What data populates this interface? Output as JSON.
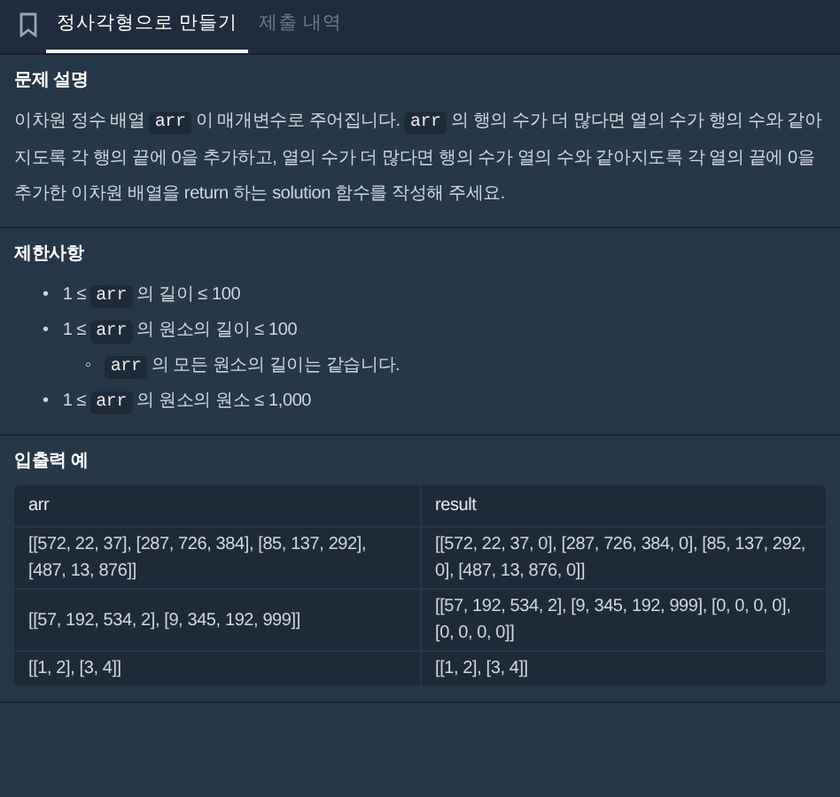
{
  "tabs": [
    {
      "label": "정사각형으로 만들기",
      "selected": true
    },
    {
      "label": "제출 내역",
      "selected": false
    }
  ],
  "sections": [
    {
      "kind": "text",
      "title": "문제 설명",
      "paragraph": [
        {
          "kind": "text",
          "text": "이차원 정수 배열 "
        },
        {
          "kind": "code",
          "text": "arr"
        },
        {
          "kind": "text",
          "text": " 이 매개변수로 주어집니다. "
        },
        {
          "kind": "code",
          "text": "arr"
        },
        {
          "kind": "text",
          "text": " 의 행의 수가 더 많다면 열의 수가 행의 수와 같아지도록 각 행의 끝에 0을 추가하고, 열의 수가 더 많다면 행의 수가 열의 수와 같아지도록 각 열의 끝에 0을 추가한 이차원 배열을 return 하는 solution 함수를 작성해 주세요."
        }
      ]
    },
    {
      "kind": "list",
      "title": "제한사항",
      "items": [
        {
          "marker": "•",
          "parts": [
            {
              "kind": "text",
              "text": "1 ≤ "
            },
            {
              "kind": "code",
              "text": "arr"
            },
            {
              "kind": "text",
              "text": " 의 길이 ≤ 100"
            }
          ]
        },
        {
          "marker": "•",
          "parts": [
            {
              "kind": "text",
              "text": "1 ≤ "
            },
            {
              "kind": "code",
              "text": "arr"
            },
            {
              "kind": "text",
              "text": " 의 원소의 길이 ≤ 100"
            }
          ],
          "children": [
            {
              "marker": "◦",
              "parts": [
                {
                  "kind": "code",
                  "text": "arr"
                },
                {
                  "kind": "text",
                  "text": " 의 모든 원소의 길이는 같습니다."
                }
              ]
            }
          ]
        },
        {
          "marker": "•",
          "parts": [
            {
              "kind": "text",
              "text": "1 ≤ "
            },
            {
              "kind": "code",
              "text": "arr"
            },
            {
              "kind": "text",
              "text": " 의 원소의 원소 ≤ 1,000"
            }
          ]
        }
      ]
    },
    {
      "kind": "table",
      "title": "입출력 예",
      "columns": [
        "arr",
        "result"
      ],
      "rows": [
        [
          "[[572, 22, 37], [287, 726, 384], [85, 137, 292], [487, 13, 876]]",
          "[[572, 22, 37, 0], [287, 726, 384, 0], [85, 137, 292, 0], [487, 13, 876, 0]]"
        ],
        [
          "[[57, 192, 534, 2], [9, 345, 192, 999]]",
          "[[57, 192, 534, 2], [9, 345, 192, 999], [0, 0, 0, 0], [0, 0, 0, 0]]"
        ],
        [
          "[[1, 2], [3, 4]]",
          "[[1, 2], [3, 4]]"
        ]
      ]
    }
  ]
}
